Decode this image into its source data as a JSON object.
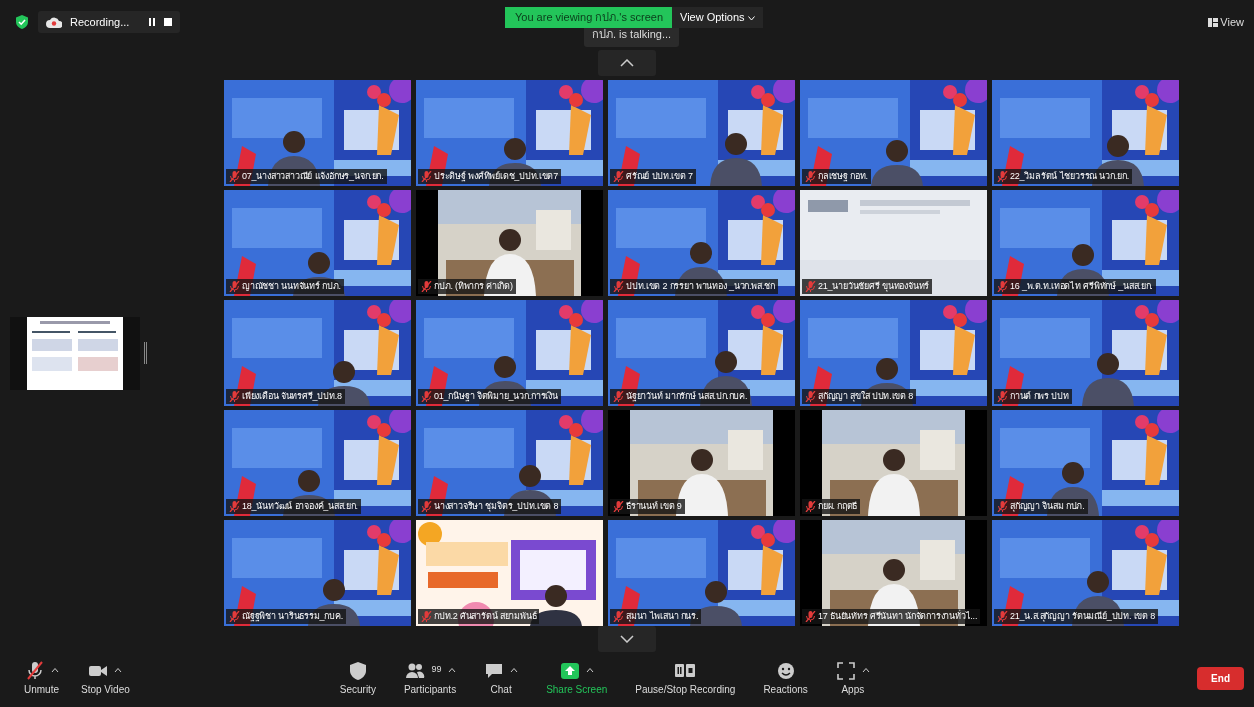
{
  "top_bar": {
    "recording_label": "Recording...",
    "viewing_banner": "You are viewing กปภ.'s screen",
    "view_options": "View Options",
    "talking": "กปภ. is talking...",
    "view_button": "View"
  },
  "tiles": [
    {
      "name": "07_นางสาวสาวณีย์ แจ้งอักษร_นจก.ยก.",
      "muted": true,
      "kind": "slide"
    },
    {
      "name": "ประดิษฐ์ พงศ์ทิพย์เดช_ปปท.เขต7",
      "muted": true,
      "kind": "slide"
    },
    {
      "name": "ศรัณย์ ปปท.เขต 7",
      "muted": true,
      "kind": "slide"
    },
    {
      "name": "กุลเชษฐ กอท.",
      "muted": true,
      "kind": "slide"
    },
    {
      "name": "22_วิมลรัตน์ ไชยวรรณ นวก.ยก.",
      "muted": true,
      "kind": "slide"
    },
    {
      "name": "ญาณัชชา นนทจันทร์ กปภ.",
      "muted": true,
      "kind": "slide"
    },
    {
      "name": "กปภ. (ทิพากร ค่าเกิด)",
      "muted": true,
      "kind": "camera"
    },
    {
      "name": "ปปท.เขต 2 กรรยา พานทอง _นวก.พส.ชก",
      "muted": true,
      "kind": "slide"
    },
    {
      "name": "21_นายวันชัยศรี ขุนทองจันทร์",
      "muted": true,
      "kind": "screen"
    },
    {
      "name": "16 _พ.ต.ท.เทอดไท ศรีพิทักษ์ _นสส.ยก.",
      "muted": true,
      "kind": "slide"
    },
    {
      "name": "เพียงเดือน จันทรศรี_ปปท.8",
      "muted": true,
      "kind": "slide"
    },
    {
      "name": "01_กนิษฐา จิตพิมาย_นวก.การเงิน",
      "muted": true,
      "kind": "slide"
    },
    {
      "name": "นัฐยาวันท์ มากรักษ์ นสส.ปก.กบค.",
      "muted": true,
      "kind": "slide"
    },
    {
      "name": "สุกัญญา สุขใส ปปท.เขต 8",
      "muted": true,
      "kind": "slide"
    },
    {
      "name": "กานต์ กพร ปปท",
      "muted": true,
      "kind": "slide"
    },
    {
      "name": "18_นันทวัฒน์ อาจองค์_นสส.ยก.",
      "muted": true,
      "kind": "slide"
    },
    {
      "name": "นางสาวจริษา ชุมจิตร_ปปท.เขต 8",
      "muted": true,
      "kind": "slide"
    },
    {
      "name": "ธีรานนท์ เขต 9",
      "muted": true,
      "kind": "camera"
    },
    {
      "name": "กยผ. กฤตธี",
      "muted": true,
      "kind": "camera"
    },
    {
      "name": "สุกัญญา จินสม กปภ.",
      "muted": true,
      "kind": "slide"
    },
    {
      "name": "ณัฐฐพิชา นารินธรรม_กบค.",
      "muted": true,
      "kind": "slide"
    },
    {
      "name": "กปท.2 ศันสารัตน์ สยามพันธ์",
      "muted": true,
      "kind": "poster"
    },
    {
      "name": "สุมนา ไพเสนา กนร.",
      "muted": true,
      "kind": "slide"
    },
    {
      "name": "17 ธันยันทัทร ศรีนันทา นักจัดการงานทั่วไ...",
      "muted": true,
      "kind": "camera"
    },
    {
      "name": "21_น.ส.สุกัญญา รัตนมณีย์_ปปท. เขต 8",
      "muted": true,
      "kind": "slide"
    }
  ],
  "toolbar_left": [
    {
      "label": "Unmute",
      "kind": "mic-off",
      "menu": true
    },
    {
      "label": "Stop Video",
      "kind": "video",
      "menu": true
    }
  ],
  "toolbar_center": [
    {
      "label": "Security",
      "kind": "shield",
      "menu": false
    },
    {
      "label": "Participants",
      "kind": "people",
      "count": "99",
      "menu": true
    },
    {
      "label": "Chat",
      "kind": "chat",
      "menu": true
    },
    {
      "label": "Share Screen",
      "kind": "share",
      "menu": true
    },
    {
      "label": "Pause/Stop Recording",
      "kind": "record",
      "menu": false
    },
    {
      "label": "Reactions",
      "kind": "smile",
      "menu": false
    },
    {
      "label": "Apps",
      "kind": "apps",
      "menu": true
    }
  ],
  "end_button": "End"
}
